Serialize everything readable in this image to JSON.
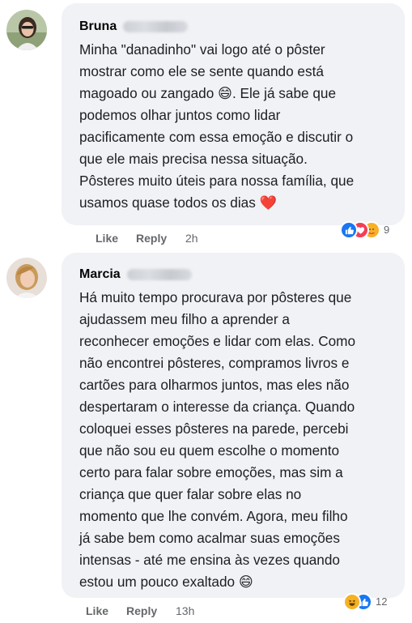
{
  "comments": [
    {
      "author": "Bruna",
      "lines": [
        "Minha \"danadinho\" vai logo até o pôster",
        "mostrar como ele se sente quando está",
        "magoado ou zangado 😄. Ele já sabe que",
        "podemos olhar juntos como lidar",
        "pacificamente com essa emoção e discutir o",
        "que ele mais precisa nessa situação.",
        "Pôsteres muito úteis para nossa família, que",
        "usamos quase todos os dias ❤️"
      ],
      "like": "Like",
      "reply": "Reply",
      "time": "2h",
      "reaction_count": "9",
      "reactions": [
        "like-icon",
        "love-icon",
        "care-icon"
      ]
    },
    {
      "author": "Marcia",
      "lines": [
        "Há muito tempo procurava por pôsteres que",
        "ajudassem meu filho a aprender a",
        "reconhecer emoções e lidar com elas. Como",
        "não encontrei pôsteres, compramos livros e",
        "cartões para olharmos juntos, mas eles não",
        "despertaram o interesse da criança. Quando",
        "coloquei esses pôsteres na parede, percebi",
        "que não sou eu quem escolhe o momento",
        "certo para falar sobre emoções, mas sim a",
        "criança que quer falar sobre elas no",
        "momento que lhe convém. Agora, meu filho",
        "já sabe bem como acalmar suas emoções",
        "intensas - até me ensina às vezes quando",
        "estou um pouco exaltado 😄"
      ],
      "like": "Like",
      "reply": "Reply",
      "time": "13h",
      "reaction_count": "12",
      "reactions": [
        "haha-icon",
        "like-icon"
      ]
    }
  ],
  "colors": {
    "bubble": "#f0f2f5",
    "like_blue": "#1877f2",
    "love_red": "#f33e58",
    "haha_yellow": "#f7b125"
  }
}
